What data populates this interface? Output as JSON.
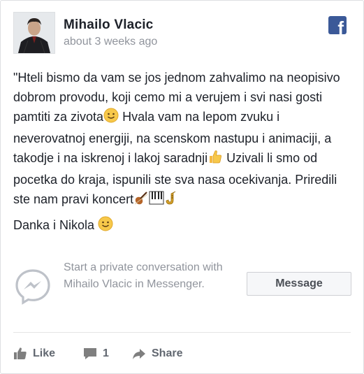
{
  "post": {
    "author": "Mihailo Vlacic",
    "timestamp": "about 3 weeks ago",
    "logo": "facebook-logo",
    "text_part1": "\"Hteli bismo da vam se jos jednom zahvalimo na neopisivo dobrom provodu, koji cemo mi a verujem i svi nasi gosti pamtiti za zivota",
    "text_part2": " Hvala vam na lepom zvuku i neverovatnoj energiji, na scenskom nastupu i animaciji, a takodje i na iskrenoj i lakoj saradnji",
    "text_part3": " Uzivali li smo od pocetka do kraja, ispunili ste sva nasa ocekivanja. Priredili ste nam pravi koncert",
    "signature": "Danka i Nikola ",
    "emoji_icons": [
      "smiley-emoji",
      "thumbs-up-emoji",
      "violin-emoji",
      "piano-emoji",
      "saxophone-emoji"
    ]
  },
  "messenger": {
    "icon": "messenger-icon",
    "prompt": "Start a private conversation with Mihailo Vlacic in Messenger.",
    "button_label": "Message"
  },
  "actions": {
    "like_label": "Like",
    "comment_count": "1",
    "share_label": "Share"
  },
  "colors": {
    "facebook_blue": "#3b5998",
    "text": "#1d2129",
    "muted": "#90949c",
    "action": "#616770"
  }
}
